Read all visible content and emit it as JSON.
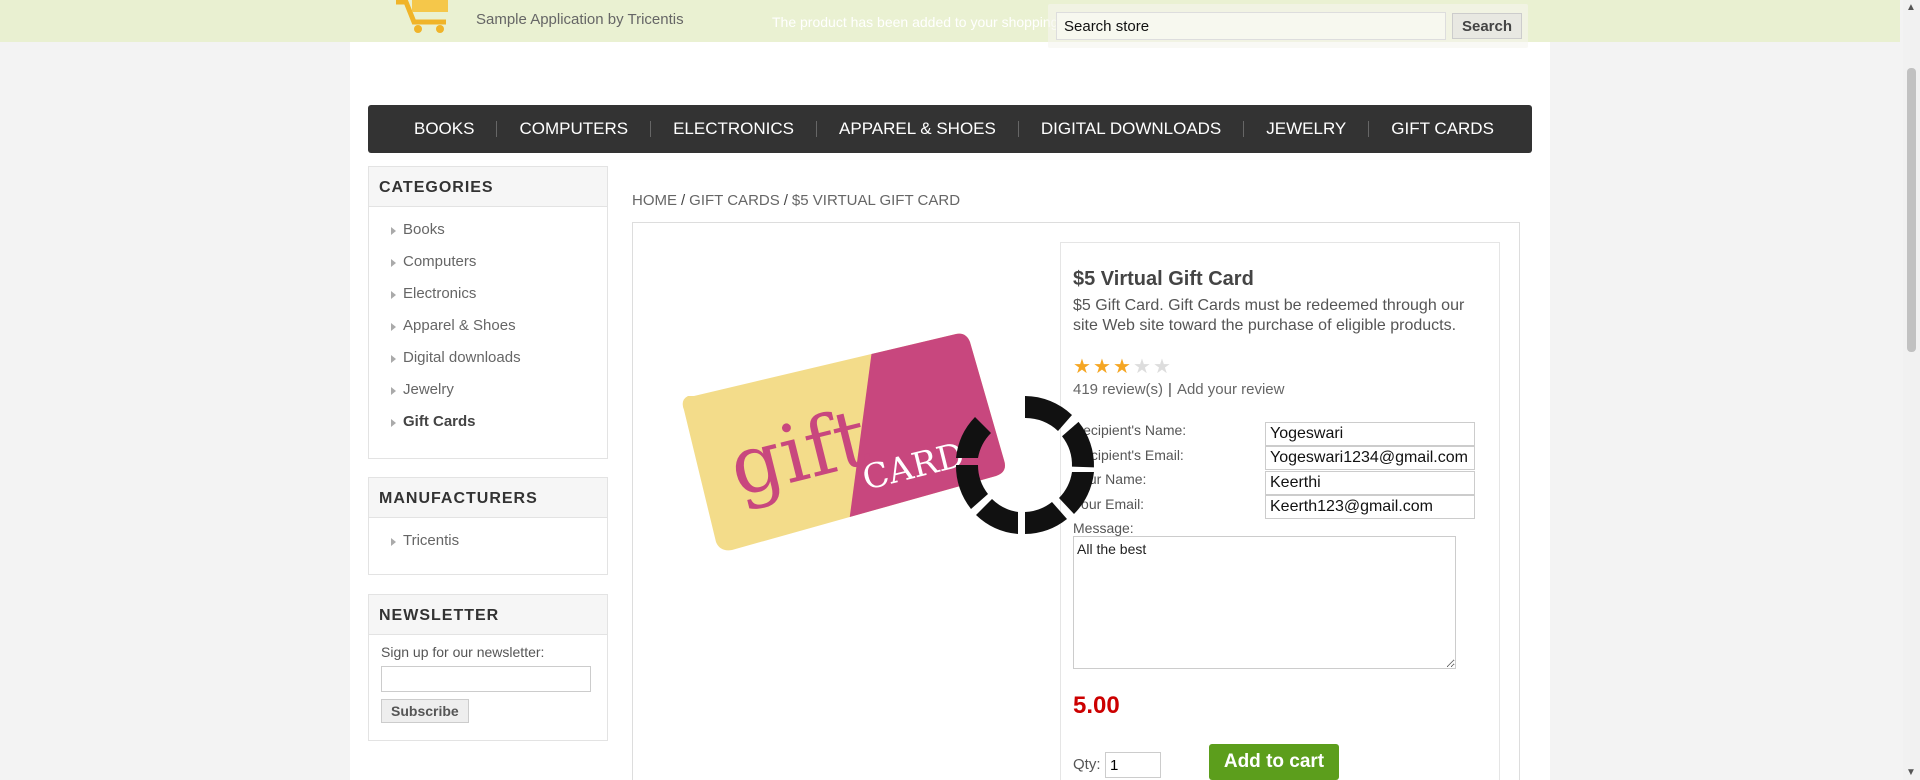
{
  "header": {
    "logo_subtitle": "Sample Application by Tricentis",
    "notification": "The product has been added to your shopping cart",
    "search": {
      "value": "Search store",
      "button": "Search"
    }
  },
  "top_menu": [
    "BOOKS",
    "COMPUTERS",
    "ELECTRONICS",
    "APPAREL & SHOES",
    "DIGITAL DOWNLOADS",
    "JEWELRY",
    "GIFT CARDS"
  ],
  "categories": {
    "title": "CATEGORIES",
    "items": [
      "Books",
      "Computers",
      "Electronics",
      "Apparel & Shoes",
      "Digital downloads",
      "Jewelry",
      "Gift Cards"
    ],
    "active": "Gift Cards"
  },
  "manufacturers": {
    "title": "MANUFACTURERS",
    "items": [
      "Tricentis"
    ]
  },
  "newsletter": {
    "title": "NEWSLETTER",
    "label": "Sign up for our newsletter:",
    "button": "Subscribe"
  },
  "breadcrumb": [
    "HOME",
    "GIFT CARDS",
    "$5 VIRTUAL GIFT CARD"
  ],
  "product": {
    "name": "$5 Virtual Gift Card",
    "description": "$5 Gift Card. Gift Cards must be redeemed through our site Web site toward the purchase of eligible products.",
    "rating": 3,
    "rating_max": 5,
    "reviews": "419 review(s)",
    "add_review": "Add your review",
    "image_text": {
      "line1": "gift",
      "line2": "CARD"
    },
    "fields": {
      "recipient_name_label": "Recipient's Name:",
      "recipient_name": "Yogeswari",
      "recipient_email_label": "Recipient's Email:",
      "recipient_email": "Yogeswari1234@gmail.com",
      "your_name_label": "Your Name:",
      "your_name": "Keerthi",
      "your_email_label": "Your Email:",
      "your_email": "Keerth123@gmail.com",
      "message_label": "Message:",
      "message": "All the best"
    },
    "price": "5.00",
    "qty_label": "Qty:",
    "qty": "1",
    "add_to_cart": "Add to cart"
  },
  "colors": {
    "price": "#cc0000",
    "add_to_cart": "#5c9e1c",
    "menu_bg": "#333333",
    "star": "#f5a623"
  }
}
